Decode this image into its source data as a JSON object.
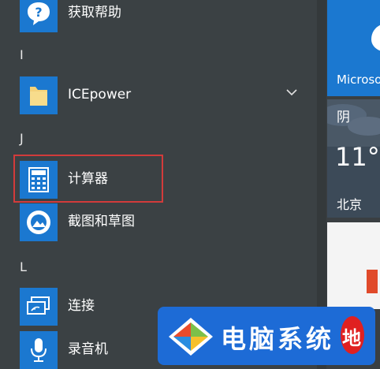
{
  "app_list": {
    "items_top": [
      {
        "label": "获取帮助",
        "icon": "help-chat-icon"
      }
    ],
    "sections": [
      {
        "letter": "I"
      },
      {
        "letter": "J"
      },
      {
        "letter": "L"
      }
    ],
    "items": [
      {
        "label": "ICEpower",
        "icon": "folder-icon"
      },
      {
        "label": "计算器",
        "icon": "calculator-icon"
      },
      {
        "label": "截图和草图",
        "icon": "snip-sketch-icon"
      },
      {
        "label": "连接",
        "icon": "connect-icon"
      },
      {
        "label": "录音机",
        "icon": "microphone-icon"
      }
    ]
  },
  "tiles": {
    "store_label": "Microso",
    "weather": {
      "condition": "阴",
      "temperature": "11°",
      "city": "北京"
    }
  },
  "watermark": {
    "text": "电脑系统",
    "badge": "地"
  },
  "colors": {
    "background": "#3b4144",
    "tile_blue": "#1b78d0",
    "highlight": "#d23b3b"
  }
}
